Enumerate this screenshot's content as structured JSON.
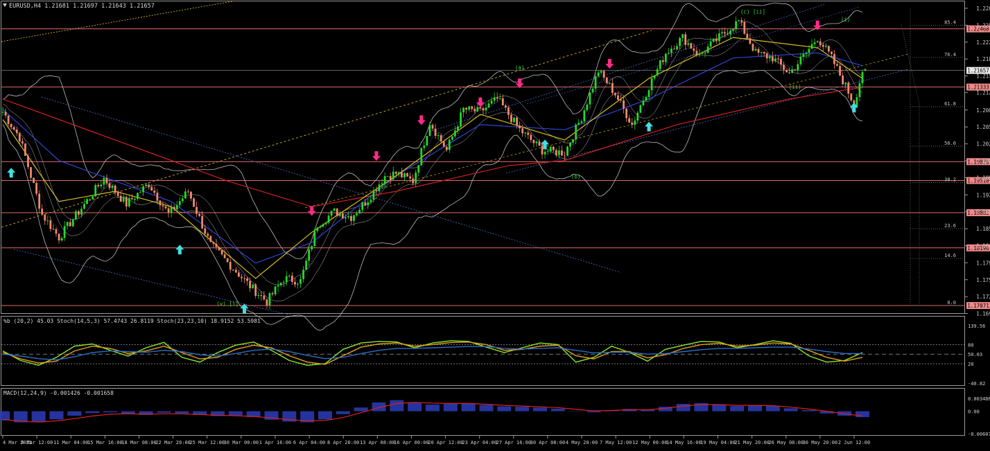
{
  "chart_data": [
    {
      "type": "candlestick",
      "panel": "main",
      "header": "EURUSD,H4  1.21681 1.21697 1.21643 1.21657",
      "symbol": "EURUSD",
      "timeframe": "H4",
      "ohlc_last": {
        "open": 1.21681,
        "high": 1.21697,
        "low": 1.21643,
        "close": 1.21657
      },
      "ylim": [
        1.1695,
        1.2295
      ],
      "x_tick_labels": [
        "4 Mar 2021",
        "8 Mar 12:00",
        "11 Mar 04:00",
        "15 Mar 16:00",
        "18 Mar 08:00",
        "22 Mar 20:00",
        "25 Mar 12:00",
        "30 Mar 00:00",
        "1 Apr 16:00",
        "6 Apr 04:00",
        "8 Apr 20:00",
        "13 Apr 08:00",
        "16 Apr 00:00",
        "20 Apr 12:00",
        "23 Apr 04:00",
        "27 Apr 16:00",
        "30 Apr 08:00",
        "4 May 20:00",
        "7 May 12:00",
        "12 May 00:00",
        "14 May 16:00",
        "19 May 04:00",
        "21 May 20:00",
        "26 May 08:00",
        "30 May 20:00",
        "2 Jun 12:00"
      ],
      "y_tick_labels": [
        "1.22870",
        "1.22540",
        "1.22210",
        "1.21880",
        "1.21550",
        "1.21225",
        "1.20885",
        "1.20555",
        "1.20225",
        "1.19895",
        "1.19565",
        "1.19230",
        "1.18900",
        "1.18570",
        "1.18240",
        "1.17905",
        "1.17575",
        "1.17245",
        "1.16915"
      ],
      "y_tick_values": [
        1.2287,
        1.2254,
        1.2221,
        1.2188,
        1.2155,
        1.21225,
        1.20885,
        1.20555,
        1.20225,
        1.19895,
        1.19565,
        1.1923,
        1.189,
        1.1857,
        1.1824,
        1.17905,
        1.17575,
        1.17245,
        1.16915
      ],
      "horizontal_levels": [
        {
          "label": "1.22468",
          "value": 1.22468
        },
        {
          "label": "1.21333",
          "value": 1.21333
        },
        {
          "label": "1.19878",
          "value": 1.19878
        },
        {
          "label": "1.19510",
          "value": 1.1951
        },
        {
          "label": "1.18882",
          "value": 1.18882
        },
        {
          "label": "1.18196",
          "value": 1.18196
        },
        {
          "label": "1.17071",
          "value": 1.17071
        }
      ],
      "current_price_label": "1.21657",
      "current_price": 1.21657,
      "fibonacci_levels": [
        {
          "label": "85.4",
          "value": 1.2254
        },
        {
          "label": "76.4",
          "value": 1.2191
        },
        {
          "label": "61.8",
          "value": 1.2095
        },
        {
          "label": "50.0",
          "value": 1.2018
        },
        {
          "label": "38.2",
          "value": 1.1947
        },
        {
          "label": "23.6",
          "value": 1.1857
        },
        {
          "label": "14.6",
          "value": 1.1799
        },
        {
          "label": "0.0",
          "value": 1.1707
        }
      ],
      "price_path": [
        {
          "x": 0,
          "y": 1.2085
        },
        {
          "x": 6,
          "y": 1.2035
        },
        {
          "x": 14,
          "y": 1.1885
        },
        {
          "x": 20,
          "y": 1.184
        },
        {
          "x": 27,
          "y": 1.189
        },
        {
          "x": 36,
          "y": 1.1955
        },
        {
          "x": 44,
          "y": 1.1905
        },
        {
          "x": 52,
          "y": 1.1945
        },
        {
          "x": 59,
          "y": 1.1885
        },
        {
          "x": 66,
          "y": 1.193
        },
        {
          "x": 74,
          "y": 1.1825
        },
        {
          "x": 82,
          "y": 1.178
        },
        {
          "x": 88,
          "y": 1.1745
        },
        {
          "x": 94,
          "y": 1.1715
        },
        {
          "x": 100,
          "y": 1.176
        },
        {
          "x": 106,
          "y": 1.1755
        },
        {
          "x": 112,
          "y": 1.1865
        },
        {
          "x": 118,
          "y": 1.189
        },
        {
          "x": 124,
          "y": 1.188
        },
        {
          "x": 130,
          "y": 1.1915
        },
        {
          "x": 136,
          "y": 1.196
        },
        {
          "x": 140,
          "y": 1.1965
        },
        {
          "x": 146,
          "y": 1.195
        },
        {
          "x": 152,
          "y": 1.2065
        },
        {
          "x": 158,
          "y": 1.201
        },
        {
          "x": 164,
          "y": 1.209
        },
        {
          "x": 170,
          "y": 1.2085
        },
        {
          "x": 176,
          "y": 1.211
        },
        {
          "x": 184,
          "y": 1.205
        },
        {
          "x": 192,
          "y": 1.201
        },
        {
          "x": 200,
          "y": 1.2005
        },
        {
          "x": 206,
          "y": 1.2075
        },
        {
          "x": 212,
          "y": 1.2165
        },
        {
          "x": 218,
          "y": 1.212
        },
        {
          "x": 224,
          "y": 1.206
        },
        {
          "x": 230,
          "y": 1.2135
        },
        {
          "x": 236,
          "y": 1.22
        },
        {
          "x": 242,
          "y": 1.223
        },
        {
          "x": 248,
          "y": 1.2195
        },
        {
          "x": 256,
          "y": 1.2235
        },
        {
          "x": 262,
          "y": 1.2262
        },
        {
          "x": 268,
          "y": 1.22
        },
        {
          "x": 274,
          "y": 1.219
        },
        {
          "x": 280,
          "y": 1.216
        },
        {
          "x": 286,
          "y": 1.22
        },
        {
          "x": 290,
          "y": 1.223
        },
        {
          "x": 295,
          "y": 1.219
        },
        {
          "x": 300,
          "y": 1.2135
        },
        {
          "x": 303,
          "y": 1.21
        },
        {
          "x": 306,
          "y": 1.2165
        }
      ],
      "moving_averages": [
        {
          "name": "red",
          "color": "#d42020",
          "points": [
            [
              0,
              1.211
            ],
            [
              40,
              1.203
            ],
            [
              80,
              1.195
            ],
            [
              110,
              1.19
            ],
            [
              140,
              1.193
            ],
            [
              180,
              1.198
            ],
            [
              200,
              1.199
            ],
            [
              240,
              1.206
            ],
            [
              280,
              1.211
            ],
            [
              306,
              1.2133
            ]
          ]
        },
        {
          "name": "blue",
          "color": "#2d46d8",
          "points": [
            [
              0,
              1.209
            ],
            [
              20,
              1.199
            ],
            [
              40,
              1.195
            ],
            [
              60,
              1.191
            ],
            [
              90,
              1.179
            ],
            [
              110,
              1.183
            ],
            [
              140,
              1.196
            ],
            [
              170,
              1.206
            ],
            [
              200,
              1.205
            ],
            [
              230,
              1.211
            ],
            [
              260,
              1.219
            ],
            [
              290,
              1.22
            ],
            [
              306,
              1.2175
            ]
          ]
        },
        {
          "name": "yellow",
          "color": "#d8c020",
          "points": [
            [
              0,
              1.207
            ],
            [
              20,
              1.191
            ],
            [
              40,
              1.193
            ],
            [
              60,
              1.19
            ],
            [
              90,
              1.176
            ],
            [
              110,
              1.185
            ],
            [
              140,
              1.196
            ],
            [
              170,
              1.208
            ],
            [
              200,
              1.203
            ],
            [
              230,
              1.215
            ],
            [
              260,
              1.223
            ],
            [
              290,
              1.221
            ],
            [
              306,
              1.215
            ]
          ]
        }
      ],
      "arrows": [
        {
          "dir": "up",
          "x": 3,
          "y": 1.1965
        },
        {
          "dir": "up",
          "x": 63,
          "y": 1.1815
        },
        {
          "dir": "up",
          "x": 86,
          "y": 1.17
        },
        {
          "dir": "down",
          "x": 110,
          "y": 1.1893
        },
        {
          "dir": "down",
          "x": 133,
          "y": 1.2
        },
        {
          "dir": "down",
          "x": 149,
          "y": 1.207
        },
        {
          "dir": "down",
          "x": 170,
          "y": 1.2105
        },
        {
          "dir": "down",
          "x": 184,
          "y": 1.2142
        },
        {
          "dir": "up",
          "x": 193,
          "y": 1.202
        },
        {
          "dir": "down",
          "x": 216,
          "y": 1.218
        },
        {
          "dir": "up",
          "x": 230,
          "y": 1.2055
        },
        {
          "dir": "down",
          "x": 290,
          "y": 1.2255
        },
        {
          "dir": "up",
          "x": 303,
          "y": 1.2092
        }
      ],
      "wave_labels": [
        {
          "text": "(v) [i]",
          "x": 80,
          "y": 1.1707
        },
        {
          "text": "(a)",
          "x": 184,
          "y": 1.2168
        },
        {
          "text": "(b)",
          "x": 204,
          "y": 1.1955
        },
        {
          "text": "(c) [ii]",
          "x": 267,
          "y": 1.2277
        },
        {
          "text": "(i)",
          "x": 300,
          "y": 1.2262
        },
        {
          "text": "(ii)",
          "x": 282,
          "y": 1.213
        }
      ]
    },
    {
      "type": "line",
      "panel": "oscillator",
      "header": "%b (20,2) 45.03  Stoch(14,5,3) 57.4743 26.8119  Stoch(23,23,10) 18.9152 53.5981",
      "ylim": [
        -40.82,
        139.56
      ],
      "y_tick_labels": [
        "139.56",
        "80",
        "50.03",
        "20",
        "-40.82"
      ],
      "y_tick_values": [
        139.56,
        80,
        50.03,
        20,
        -40.82
      ],
      "series": [
        {
          "name": "%b (20,2)",
          "color": "#8ee82a",
          "values": [
            60,
            30,
            15,
            40,
            75,
            82,
            62,
            44,
            70,
            87,
            40,
            25,
            55,
            78,
            88,
            62,
            30,
            15,
            20,
            65,
            85,
            90,
            88,
            70,
            85,
            92,
            90,
            72,
            55,
            70,
            85,
            80,
            25,
            40,
            75,
            55,
            28,
            65,
            78,
            90,
            88,
            70,
            80,
            92,
            84,
            45,
            25,
            30,
            55
          ]
        },
        {
          "name": "Stoch(14,5,3)",
          "color": "#e8a020",
          "values": [
            55,
            35,
            22,
            28,
            60,
            75,
            68,
            52,
            60,
            75,
            55,
            35,
            40,
            65,
            78,
            70,
            45,
            25,
            18,
            45,
            72,
            82,
            85,
            75,
            80,
            86,
            88,
            80,
            62,
            65,
            75,
            78,
            45,
            35,
            58,
            58,
            38,
            48,
            68,
            80,
            84,
            75,
            78,
            85,
            82,
            62,
            40,
            28,
            40
          ]
        },
        {
          "name": "Stoch(23,23,10)",
          "color": "#2a6ec8",
          "values": [
            50,
            44,
            36,
            32,
            42,
            55,
            60,
            58,
            56,
            62,
            58,
            48,
            44,
            52,
            62,
            66,
            58,
            46,
            36,
            40,
            52,
            62,
            68,
            68,
            70,
            72,
            74,
            74,
            68,
            66,
            68,
            70,
            62,
            54,
            56,
            56,
            50,
            52,
            58,
            64,
            68,
            68,
            70,
            72,
            72,
            66,
            58,
            52,
            52
          ]
        }
      ],
      "current_value_label": "50.03"
    },
    {
      "type": "bar",
      "panel": "macd",
      "header": "MACD(12,24,9) -0.001426 -0.001658",
      "ylim": [
        -0.006075,
        0.003486
      ],
      "y_tick_labels": [
        "0.003486",
        "0.00",
        "-0.006075"
      ],
      "y_tick_values": [
        0.003486,
        0.0,
        -0.006075
      ],
      "histogram": [
        -0.0025,
        -0.003,
        -0.0028,
        -0.0022,
        -0.0012,
        -0.0005,
        -0.0003,
        -0.0008,
        -0.001,
        -0.0004,
        -0.0006,
        -0.001,
        -0.0013,
        -0.0011,
        -0.0016,
        -0.0023,
        -0.0028,
        -0.003,
        -0.0022,
        -0.0008,
        0.001,
        0.0024,
        0.003,
        0.0024,
        0.0018,
        0.002,
        0.0022,
        0.0017,
        0.0013,
        0.0012,
        0.001,
        0.0007,
        0.0,
        -0.0003,
        0.0003,
        0.0006,
        0.0004,
        0.0012,
        0.002,
        0.0022,
        0.0018,
        0.0014,
        0.0017,
        0.0015,
        0.0008,
        0.0003,
        -0.0006,
        -0.0012,
        -0.0016
      ],
      "signal": [
        -0.0022,
        -0.0027,
        -0.0029,
        -0.0026,
        -0.002,
        -0.0013,
        -0.0008,
        -0.0007,
        -0.0008,
        -0.0007,
        -0.0007,
        -0.0009,
        -0.0011,
        -0.0012,
        -0.0014,
        -0.0018,
        -0.0023,
        -0.0026,
        -0.0025,
        -0.0017,
        -0.0004,
        0.001,
        0.0021,
        0.0024,
        0.0022,
        0.0021,
        0.0021,
        0.0019,
        0.0016,
        0.0014,
        0.0012,
        0.001,
        0.0005,
        0.0001,
        0.0002,
        0.0004,
        0.0004,
        0.0008,
        0.0014,
        0.0018,
        0.0018,
        0.0016,
        0.0016,
        0.0015,
        0.0011,
        0.0006,
        0.0,
        -0.0007,
        -0.0013
      ]
    }
  ]
}
